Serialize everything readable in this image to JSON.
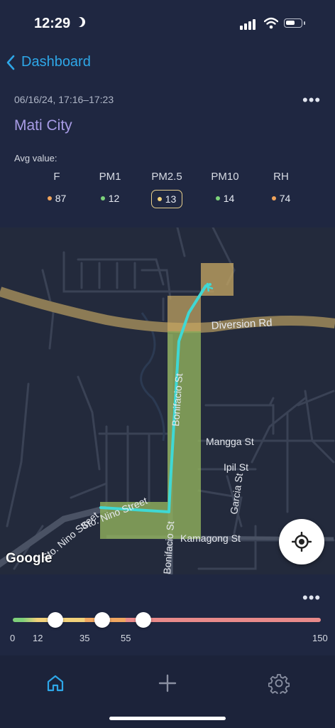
{
  "status_bar": {
    "time": "12:29"
  },
  "nav": {
    "back_label": "Dashboard"
  },
  "session": {
    "date_range": "06/16/24, 17:16–17:23",
    "location": "Mati City",
    "more_icon": "more-horizontal-icon"
  },
  "metrics": {
    "heading": "Avg value:",
    "items": [
      {
        "name": "F",
        "value": "87",
        "dot_color": "#f0a35a",
        "selected": false
      },
      {
        "name": "PM1",
        "value": "12",
        "dot_color": "#7cd27a",
        "selected": false
      },
      {
        "name": "PM2.5",
        "value": "13",
        "dot_color": "#f3d37a",
        "selected": true
      },
      {
        "name": "PM10",
        "value": "14",
        "dot_color": "#7cd27a",
        "selected": false
      },
      {
        "name": "RH",
        "value": "74",
        "dot_color": "#f0a35a",
        "selected": false
      }
    ]
  },
  "map": {
    "attribution": "Google",
    "streets": [
      "Diversion Rd",
      "Bonifacio St",
      "Mangga St",
      "Ipil St",
      "Garcia St",
      "Sto. Nino Street",
      "Kamagong St",
      "Bonifacio St",
      "Sto. Nino Street"
    ],
    "route_color": "#3fd8d4",
    "zone_color_green": "#8fae5c",
    "zone_color_yellow": "#c9aa63",
    "locate_icon": "locate-crosshair-icon"
  },
  "scale": {
    "ticks": [
      "0",
      "12",
      "35",
      "55",
      "150"
    ],
    "handle_values": [
      12,
      35,
      55
    ],
    "max": 150,
    "colors": {
      "green": "#7fd07a",
      "yellow": "#f2d27a",
      "orange": "#f0a660",
      "red": "#e98a8a"
    }
  },
  "tabs": [
    {
      "name": "home",
      "icon": "home-icon",
      "active": true
    },
    {
      "name": "add",
      "icon": "plus-icon",
      "active": false
    },
    {
      "name": "settings",
      "icon": "gear-icon",
      "active": false
    }
  ],
  "colors": {
    "accent": "#2ea7e8",
    "title": "#a89ce6",
    "background": "#1f2741"
  }
}
